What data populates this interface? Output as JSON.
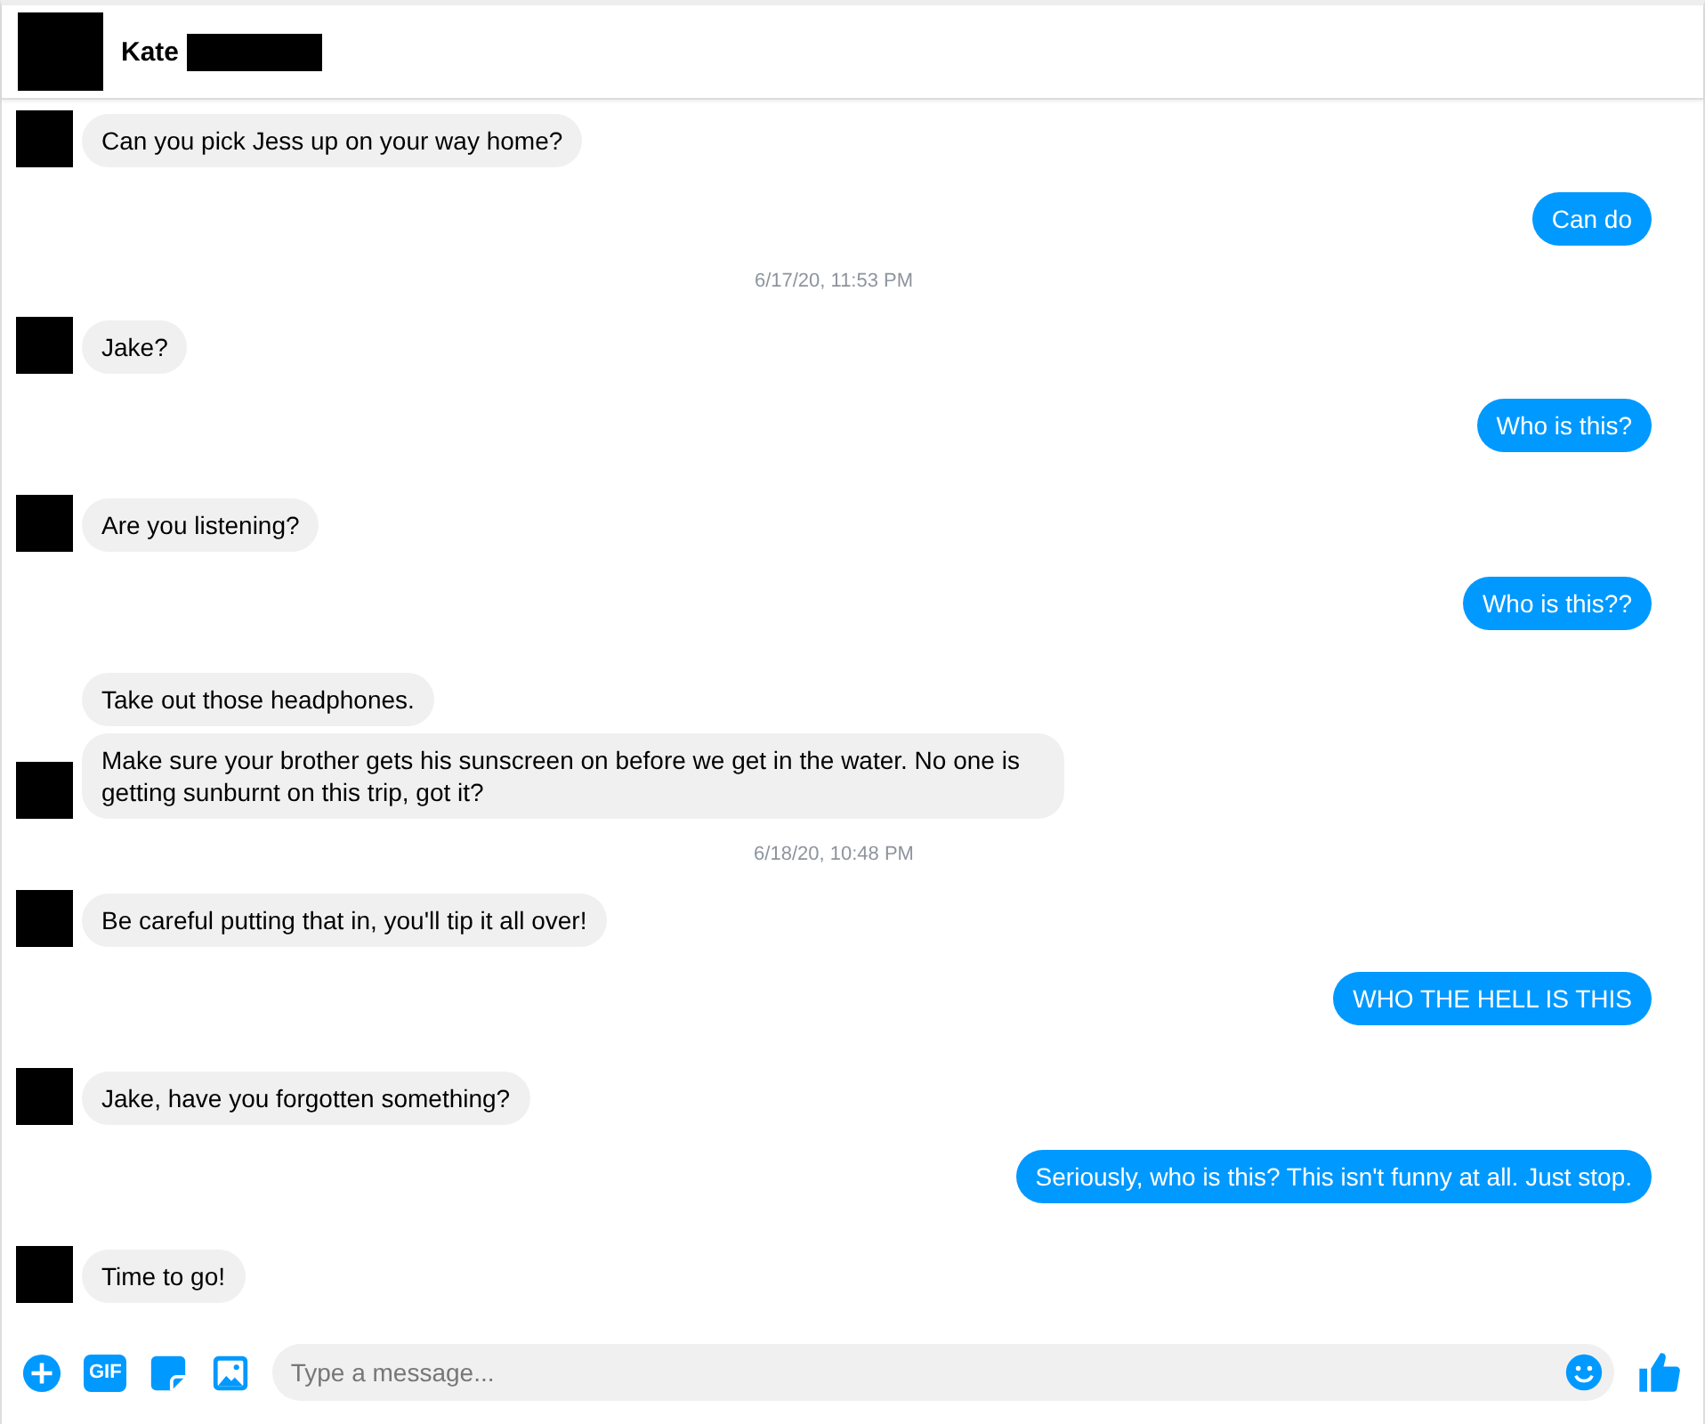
{
  "header": {
    "name": "Kate"
  },
  "messages": [
    {
      "kind": "incoming",
      "text": "Can you pick Jess up on your way home?",
      "avatar": true
    },
    {
      "kind": "outgoing",
      "text": "Can do"
    },
    {
      "kind": "timestamp",
      "text": "6/17/20, 11:53 PM"
    },
    {
      "kind": "incoming",
      "text": "Jake?",
      "avatar": true
    },
    {
      "kind": "outgoing",
      "text": "Who is this?"
    },
    {
      "kind": "incoming",
      "text": "Are you listening?",
      "avatar": true
    },
    {
      "kind": "outgoing",
      "text": "Who is this??"
    },
    {
      "kind": "incoming",
      "text": "Take out those headphones.",
      "avatar": false
    },
    {
      "kind": "incoming",
      "text": "Make sure your brother gets his sunscreen on before we get in the water. No one is getting sunburnt on this trip, got it?",
      "avatar": true
    },
    {
      "kind": "timestamp",
      "text": "6/18/20, 10:48 PM"
    },
    {
      "kind": "incoming",
      "text": "Be careful putting that in, you'll tip it all over!",
      "avatar": true
    },
    {
      "kind": "outgoing",
      "text": "WHO THE HELL IS THIS"
    },
    {
      "kind": "incoming",
      "text": "Jake, have you forgotten something?",
      "avatar": true
    },
    {
      "kind": "outgoing",
      "text": "Seriously, who is this? This isn't funny at all. Just stop."
    },
    {
      "kind": "incoming",
      "text": "Time to go!",
      "avatar": true
    }
  ],
  "composer": {
    "gif_label": "GIF",
    "placeholder": "Type a message..."
  }
}
